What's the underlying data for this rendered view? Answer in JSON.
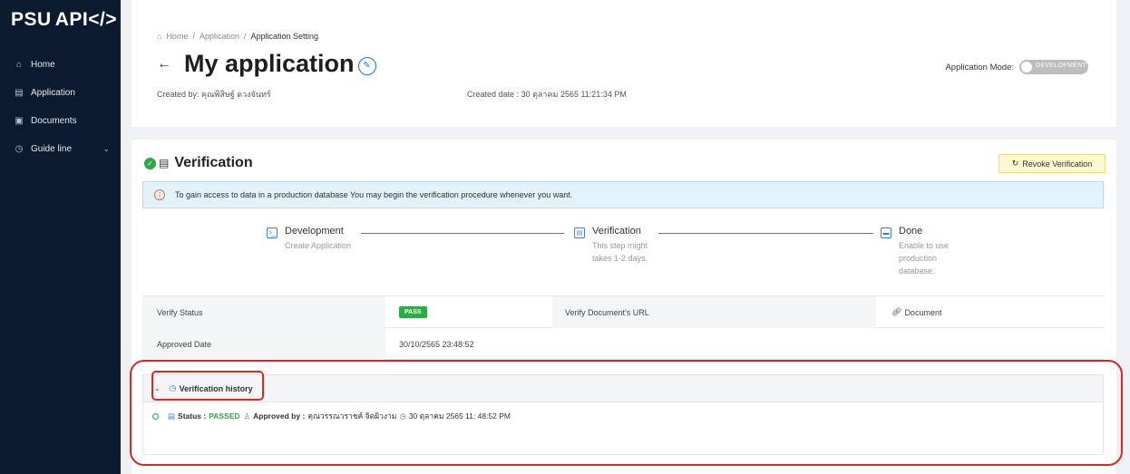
{
  "brand": {
    "logo_psu": "PSU",
    "logo_api": "API</>"
  },
  "nav": [
    {
      "icon": "⌂",
      "label": "Home"
    },
    {
      "icon": "▤",
      "label": "Application"
    },
    {
      "icon": "▣",
      "label": "Documents"
    },
    {
      "icon": "◷",
      "label": "Guide line",
      "chevron": "⌄"
    }
  ],
  "breadcrumb": {
    "home": "Home",
    "sep": "/",
    "app": "Application",
    "current": "Application Setting"
  },
  "page": {
    "title": "My application",
    "created_by_label": "Created by:",
    "created_by": "คุณพิสิษฐ์ ดวงจันทร์",
    "created_date_label": "Created date :",
    "created_date": "30 ตุลาคม 2565 11:21:34 PM",
    "mode_label": "Application Mode:",
    "mode_value": "DEVELOPMENT"
  },
  "verification": {
    "title": "Verification",
    "revoke_label": "Revoke Verification",
    "info": "To gain access to data in a production database You may begin the verification procedure whenever you want.",
    "steps": [
      {
        "title": "Development",
        "desc": [
          "Create Application"
        ]
      },
      {
        "title": "Verification",
        "desc": [
          "This step might",
          "takes 1-2 days."
        ]
      },
      {
        "title": "Done",
        "desc": [
          "Enable to use",
          "production",
          "database."
        ]
      }
    ],
    "table": {
      "verify_status_label": "Verify Status",
      "verify_status": "PASS",
      "doc_url_label": "Verify Document's URL",
      "doc_link": "Document",
      "approved_date_label": "Approved Date",
      "approved_date": "30/10/2565 23:48:52"
    },
    "history": {
      "title": "Verification history",
      "status_label": "Status :",
      "status": "PASSED",
      "approved_by_label": "Approved by :",
      "approved_by": "คุณวรรณวราชค์ จิตผิวงาม",
      "timestamp": "30 ตุลาคม 2565 11: 48:52 PM"
    }
  },
  "colors": {
    "sidebar": "#0b1a2e",
    "accent": "#3d7fcf",
    "success": "#2eaa45",
    "highlight": "#e02424",
    "revoke_bg": "#fff8d0"
  }
}
